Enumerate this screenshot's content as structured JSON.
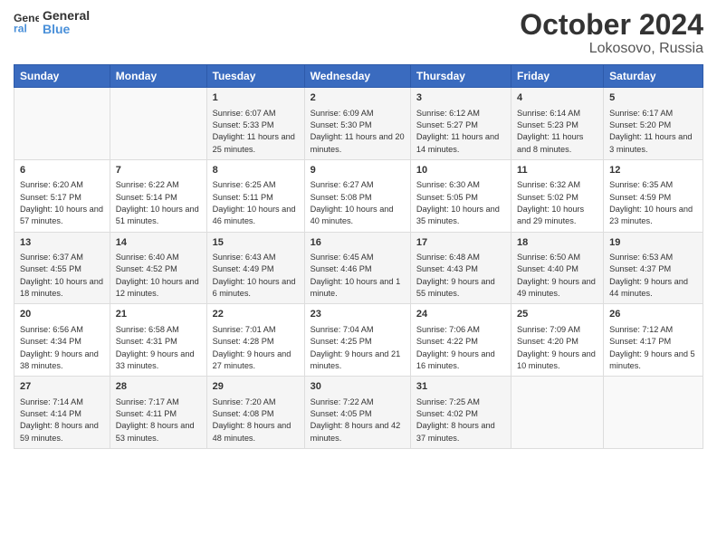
{
  "header": {
    "logo_general": "General",
    "logo_blue": "Blue",
    "month_title": "October 2024",
    "location": "Lokosovo, Russia"
  },
  "weekdays": [
    "Sunday",
    "Monday",
    "Tuesday",
    "Wednesday",
    "Thursday",
    "Friday",
    "Saturday"
  ],
  "weeks": [
    [
      {
        "day": "",
        "sunrise": "",
        "sunset": "",
        "daylight": ""
      },
      {
        "day": "",
        "sunrise": "",
        "sunset": "",
        "daylight": ""
      },
      {
        "day": "1",
        "sunrise": "Sunrise: 6:07 AM",
        "sunset": "Sunset: 5:33 PM",
        "daylight": "Daylight: 11 hours and 25 minutes."
      },
      {
        "day": "2",
        "sunrise": "Sunrise: 6:09 AM",
        "sunset": "Sunset: 5:30 PM",
        "daylight": "Daylight: 11 hours and 20 minutes."
      },
      {
        "day": "3",
        "sunrise": "Sunrise: 6:12 AM",
        "sunset": "Sunset: 5:27 PM",
        "daylight": "Daylight: 11 hours and 14 minutes."
      },
      {
        "day": "4",
        "sunrise": "Sunrise: 6:14 AM",
        "sunset": "Sunset: 5:23 PM",
        "daylight": "Daylight: 11 hours and 8 minutes."
      },
      {
        "day": "5",
        "sunrise": "Sunrise: 6:17 AM",
        "sunset": "Sunset: 5:20 PM",
        "daylight": "Daylight: 11 hours and 3 minutes."
      }
    ],
    [
      {
        "day": "6",
        "sunrise": "Sunrise: 6:20 AM",
        "sunset": "Sunset: 5:17 PM",
        "daylight": "Daylight: 10 hours and 57 minutes."
      },
      {
        "day": "7",
        "sunrise": "Sunrise: 6:22 AM",
        "sunset": "Sunset: 5:14 PM",
        "daylight": "Daylight: 10 hours and 51 minutes."
      },
      {
        "day": "8",
        "sunrise": "Sunrise: 6:25 AM",
        "sunset": "Sunset: 5:11 PM",
        "daylight": "Daylight: 10 hours and 46 minutes."
      },
      {
        "day": "9",
        "sunrise": "Sunrise: 6:27 AM",
        "sunset": "Sunset: 5:08 PM",
        "daylight": "Daylight: 10 hours and 40 minutes."
      },
      {
        "day": "10",
        "sunrise": "Sunrise: 6:30 AM",
        "sunset": "Sunset: 5:05 PM",
        "daylight": "Daylight: 10 hours and 35 minutes."
      },
      {
        "day": "11",
        "sunrise": "Sunrise: 6:32 AM",
        "sunset": "Sunset: 5:02 PM",
        "daylight": "Daylight: 10 hours and 29 minutes."
      },
      {
        "day": "12",
        "sunrise": "Sunrise: 6:35 AM",
        "sunset": "Sunset: 4:59 PM",
        "daylight": "Daylight: 10 hours and 23 minutes."
      }
    ],
    [
      {
        "day": "13",
        "sunrise": "Sunrise: 6:37 AM",
        "sunset": "Sunset: 4:55 PM",
        "daylight": "Daylight: 10 hours and 18 minutes."
      },
      {
        "day": "14",
        "sunrise": "Sunrise: 6:40 AM",
        "sunset": "Sunset: 4:52 PM",
        "daylight": "Daylight: 10 hours and 12 minutes."
      },
      {
        "day": "15",
        "sunrise": "Sunrise: 6:43 AM",
        "sunset": "Sunset: 4:49 PM",
        "daylight": "Daylight: 10 hours and 6 minutes."
      },
      {
        "day": "16",
        "sunrise": "Sunrise: 6:45 AM",
        "sunset": "Sunset: 4:46 PM",
        "daylight": "Daylight: 10 hours and 1 minute."
      },
      {
        "day": "17",
        "sunrise": "Sunrise: 6:48 AM",
        "sunset": "Sunset: 4:43 PM",
        "daylight": "Daylight: 9 hours and 55 minutes."
      },
      {
        "day": "18",
        "sunrise": "Sunrise: 6:50 AM",
        "sunset": "Sunset: 4:40 PM",
        "daylight": "Daylight: 9 hours and 49 minutes."
      },
      {
        "day": "19",
        "sunrise": "Sunrise: 6:53 AM",
        "sunset": "Sunset: 4:37 PM",
        "daylight": "Daylight: 9 hours and 44 minutes."
      }
    ],
    [
      {
        "day": "20",
        "sunrise": "Sunrise: 6:56 AM",
        "sunset": "Sunset: 4:34 PM",
        "daylight": "Daylight: 9 hours and 38 minutes."
      },
      {
        "day": "21",
        "sunrise": "Sunrise: 6:58 AM",
        "sunset": "Sunset: 4:31 PM",
        "daylight": "Daylight: 9 hours and 33 minutes."
      },
      {
        "day": "22",
        "sunrise": "Sunrise: 7:01 AM",
        "sunset": "Sunset: 4:28 PM",
        "daylight": "Daylight: 9 hours and 27 minutes."
      },
      {
        "day": "23",
        "sunrise": "Sunrise: 7:04 AM",
        "sunset": "Sunset: 4:25 PM",
        "daylight": "Daylight: 9 hours and 21 minutes."
      },
      {
        "day": "24",
        "sunrise": "Sunrise: 7:06 AM",
        "sunset": "Sunset: 4:22 PM",
        "daylight": "Daylight: 9 hours and 16 minutes."
      },
      {
        "day": "25",
        "sunrise": "Sunrise: 7:09 AM",
        "sunset": "Sunset: 4:20 PM",
        "daylight": "Daylight: 9 hours and 10 minutes."
      },
      {
        "day": "26",
        "sunrise": "Sunrise: 7:12 AM",
        "sunset": "Sunset: 4:17 PM",
        "daylight": "Daylight: 9 hours and 5 minutes."
      }
    ],
    [
      {
        "day": "27",
        "sunrise": "Sunrise: 7:14 AM",
        "sunset": "Sunset: 4:14 PM",
        "daylight": "Daylight: 8 hours and 59 minutes."
      },
      {
        "day": "28",
        "sunrise": "Sunrise: 7:17 AM",
        "sunset": "Sunset: 4:11 PM",
        "daylight": "Daylight: 8 hours and 53 minutes."
      },
      {
        "day": "29",
        "sunrise": "Sunrise: 7:20 AM",
        "sunset": "Sunset: 4:08 PM",
        "daylight": "Daylight: 8 hours and 48 minutes."
      },
      {
        "day": "30",
        "sunrise": "Sunrise: 7:22 AM",
        "sunset": "Sunset: 4:05 PM",
        "daylight": "Daylight: 8 hours and 42 minutes."
      },
      {
        "day": "31",
        "sunrise": "Sunrise: 7:25 AM",
        "sunset": "Sunset: 4:02 PM",
        "daylight": "Daylight: 8 hours and 37 minutes."
      },
      {
        "day": "",
        "sunrise": "",
        "sunset": "",
        "daylight": ""
      },
      {
        "day": "",
        "sunrise": "",
        "sunset": "",
        "daylight": ""
      }
    ]
  ]
}
